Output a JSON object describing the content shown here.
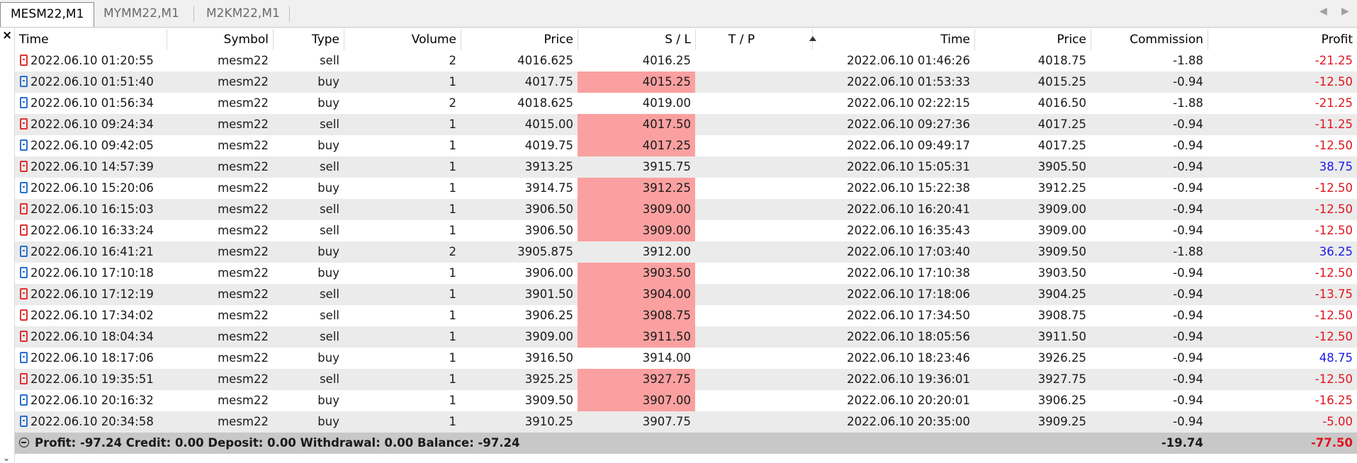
{
  "tabs": [
    {
      "label": "MESM22,M1",
      "active": true
    },
    {
      "label": "MYMM22,M1",
      "active": false
    },
    {
      "label": "M2KM22,M1",
      "active": false
    }
  ],
  "nav": {
    "prev": "◀",
    "next": "▶"
  },
  "close_label": "×",
  "columns": [
    "Time",
    "Symbol",
    "Type",
    "Volume",
    "Price",
    "S / L",
    "T / P",
    "Time",
    "Price",
    "Commission",
    "Profit"
  ],
  "rows": [
    {
      "open_time": "2022.06.10 01:20:55",
      "symbol": "mesm22",
      "type": "sell",
      "volume": "2",
      "price": "4016.625",
      "sl": "4016.25",
      "sl_hit": false,
      "tp": "",
      "close_time": "2022.06.10 01:46:26",
      "close_price": "4018.75",
      "commission": "-1.88",
      "profit": "-21.25"
    },
    {
      "open_time": "2022.06.10 01:51:40",
      "symbol": "mesm22",
      "type": "buy",
      "volume": "1",
      "price": "4017.75",
      "sl": "4015.25",
      "sl_hit": true,
      "tp": "",
      "close_time": "2022.06.10 01:53:33",
      "close_price": "4015.25",
      "commission": "-0.94",
      "profit": "-12.50"
    },
    {
      "open_time": "2022.06.10 01:56:34",
      "symbol": "mesm22",
      "type": "buy",
      "volume": "2",
      "price": "4018.625",
      "sl": "4019.00",
      "sl_hit": false,
      "tp": "",
      "close_time": "2022.06.10 02:22:15",
      "close_price": "4016.50",
      "commission": "-1.88",
      "profit": "-21.25"
    },
    {
      "open_time": "2022.06.10 09:24:34",
      "symbol": "mesm22",
      "type": "sell",
      "volume": "1",
      "price": "4015.00",
      "sl": "4017.50",
      "sl_hit": true,
      "tp": "",
      "close_time": "2022.06.10 09:27:36",
      "close_price": "4017.25",
      "commission": "-0.94",
      "profit": "-11.25"
    },
    {
      "open_time": "2022.06.10 09:42:05",
      "symbol": "mesm22",
      "type": "buy",
      "volume": "1",
      "price": "4019.75",
      "sl": "4017.25",
      "sl_hit": true,
      "tp": "",
      "close_time": "2022.06.10 09:49:17",
      "close_price": "4017.25",
      "commission": "-0.94",
      "profit": "-12.50"
    },
    {
      "open_time": "2022.06.10 14:57:39",
      "symbol": "mesm22",
      "type": "sell",
      "volume": "1",
      "price": "3913.25",
      "sl": "3915.75",
      "sl_hit": false,
      "tp": "",
      "close_time": "2022.06.10 15:05:31",
      "close_price": "3905.50",
      "commission": "-0.94",
      "profit": "38.75"
    },
    {
      "open_time": "2022.06.10 15:20:06",
      "symbol": "mesm22",
      "type": "buy",
      "volume": "1",
      "price": "3914.75",
      "sl": "3912.25",
      "sl_hit": true,
      "tp": "",
      "close_time": "2022.06.10 15:22:38",
      "close_price": "3912.25",
      "commission": "-0.94",
      "profit": "-12.50"
    },
    {
      "open_time": "2022.06.10 16:15:03",
      "symbol": "mesm22",
      "type": "sell",
      "volume": "1",
      "price": "3906.50",
      "sl": "3909.00",
      "sl_hit": true,
      "tp": "",
      "close_time": "2022.06.10 16:20:41",
      "close_price": "3909.00",
      "commission": "-0.94",
      "profit": "-12.50"
    },
    {
      "open_time": "2022.06.10 16:33:24",
      "symbol": "mesm22",
      "type": "sell",
      "volume": "1",
      "price": "3906.50",
      "sl": "3909.00",
      "sl_hit": true,
      "tp": "",
      "close_time": "2022.06.10 16:35:43",
      "close_price": "3909.00",
      "commission": "-0.94",
      "profit": "-12.50"
    },
    {
      "open_time": "2022.06.10 16:41:21",
      "symbol": "mesm22",
      "type": "buy",
      "volume": "2",
      "price": "3905.875",
      "sl": "3912.00",
      "sl_hit": false,
      "tp": "",
      "close_time": "2022.06.10 17:03:40",
      "close_price": "3909.50",
      "commission": "-1.88",
      "profit": "36.25"
    },
    {
      "open_time": "2022.06.10 17:10:18",
      "symbol": "mesm22",
      "type": "buy",
      "volume": "1",
      "price": "3906.00",
      "sl": "3903.50",
      "sl_hit": true,
      "tp": "",
      "close_time": "2022.06.10 17:10:38",
      "close_price": "3903.50",
      "commission": "-0.94",
      "profit": "-12.50"
    },
    {
      "open_time": "2022.06.10 17:12:19",
      "symbol": "mesm22",
      "type": "sell",
      "volume": "1",
      "price": "3901.50",
      "sl": "3904.00",
      "sl_hit": true,
      "tp": "",
      "close_time": "2022.06.10 17:18:06",
      "close_price": "3904.25",
      "commission": "-0.94",
      "profit": "-13.75"
    },
    {
      "open_time": "2022.06.10 17:34:02",
      "symbol": "mesm22",
      "type": "sell",
      "volume": "1",
      "price": "3906.25",
      "sl": "3908.75",
      "sl_hit": true,
      "tp": "",
      "close_time": "2022.06.10 17:34:50",
      "close_price": "3908.75",
      "commission": "-0.94",
      "profit": "-12.50"
    },
    {
      "open_time": "2022.06.10 18:04:34",
      "symbol": "mesm22",
      "type": "sell",
      "volume": "1",
      "price": "3909.00",
      "sl": "3911.50",
      "sl_hit": true,
      "tp": "",
      "close_time": "2022.06.10 18:05:56",
      "close_price": "3911.50",
      "commission": "-0.94",
      "profit": "-12.50"
    },
    {
      "open_time": "2022.06.10 18:17:06",
      "symbol": "mesm22",
      "type": "buy",
      "volume": "1",
      "price": "3916.50",
      "sl": "3914.00",
      "sl_hit": false,
      "tp": "",
      "close_time": "2022.06.10 18:23:46",
      "close_price": "3926.25",
      "commission": "-0.94",
      "profit": "48.75"
    },
    {
      "open_time": "2022.06.10 19:35:51",
      "symbol": "mesm22",
      "type": "sell",
      "volume": "1",
      "price": "3925.25",
      "sl": "3927.75",
      "sl_hit": true,
      "tp": "",
      "close_time": "2022.06.10 19:36:01",
      "close_price": "3927.75",
      "commission": "-0.94",
      "profit": "-12.50"
    },
    {
      "open_time": "2022.06.10 20:16:32",
      "symbol": "mesm22",
      "type": "buy",
      "volume": "1",
      "price": "3909.50",
      "sl": "3907.00",
      "sl_hit": true,
      "tp": "",
      "close_time": "2022.06.10 20:20:01",
      "close_price": "3906.25",
      "commission": "-0.94",
      "profit": "-16.25"
    },
    {
      "open_time": "2022.06.10 20:34:58",
      "symbol": "mesm22",
      "type": "buy",
      "volume": "1",
      "price": "3910.25",
      "sl": "3907.75",
      "sl_hit": false,
      "tp": "",
      "close_time": "2022.06.10 20:35:00",
      "close_price": "3909.25",
      "commission": "-0.94",
      "profit": "-5.00"
    }
  ],
  "footer": {
    "summary": "Profit: -97.24   Credit: 0.00   Deposit: 0.00   Withdrawal: 0.00   Balance: -97.24",
    "commission_total": "-19.74",
    "profit_total": "-77.50"
  },
  "colors": {
    "sell_icon": "#e03030",
    "buy_icon": "#2a6fd0",
    "sl_hit_bg": "#fba0a0",
    "negative": "#e0141e",
    "positive": "#1a1ae8",
    "footer_bg": "#c8c8c8"
  }
}
